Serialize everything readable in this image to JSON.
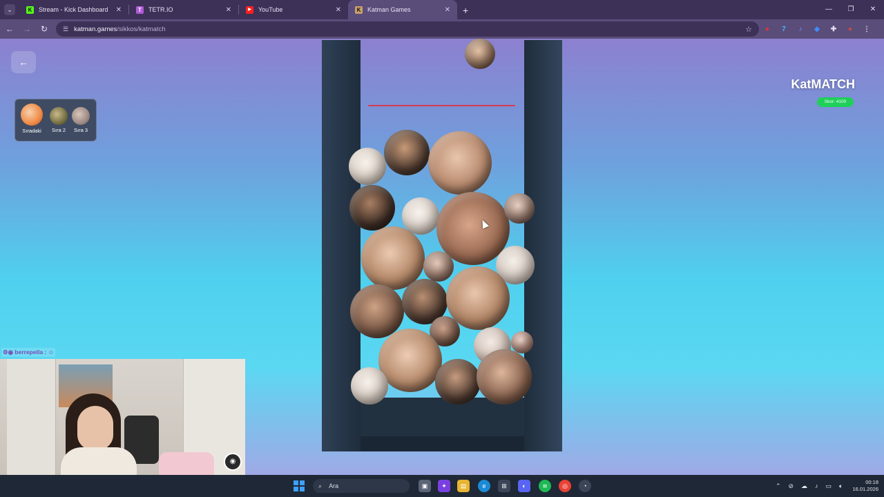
{
  "browser": {
    "tabs": [
      {
        "title": "Stream - Kick Dashboard",
        "favicon": "K",
        "color": "#53fc18",
        "active": false
      },
      {
        "title": "TETR.IO",
        "favicon": "T",
        "color": "#b05bd6",
        "active": false
      },
      {
        "title": "YouTube",
        "favicon": "▶",
        "color": "#ff1f1f",
        "active": false
      },
      {
        "title": "Katman Games",
        "favicon": "K",
        "color": "#c9a06a",
        "active": true
      }
    ],
    "url_domain": "katman.games",
    "url_path": "/sikkos/katmatch"
  },
  "game": {
    "title": "KatMATCH",
    "score_label": "Skor: 4100",
    "queue": [
      {
        "label": "Sıradaki",
        "color": "#f08a44"
      },
      {
        "label": "Sıra 2",
        "color": "#7c7a4a"
      },
      {
        "label": "Sıra 3",
        "color": "#9e8a86"
      }
    ]
  },
  "chat": {
    "username": "berrepella :"
  },
  "taskbar": {
    "search_placeholder": "Ara",
    "time": "00:18",
    "date": "16.01.2026"
  },
  "icons": {
    "back": "arrow-left-icon",
    "search": "search-icon",
    "star": "star-icon"
  }
}
